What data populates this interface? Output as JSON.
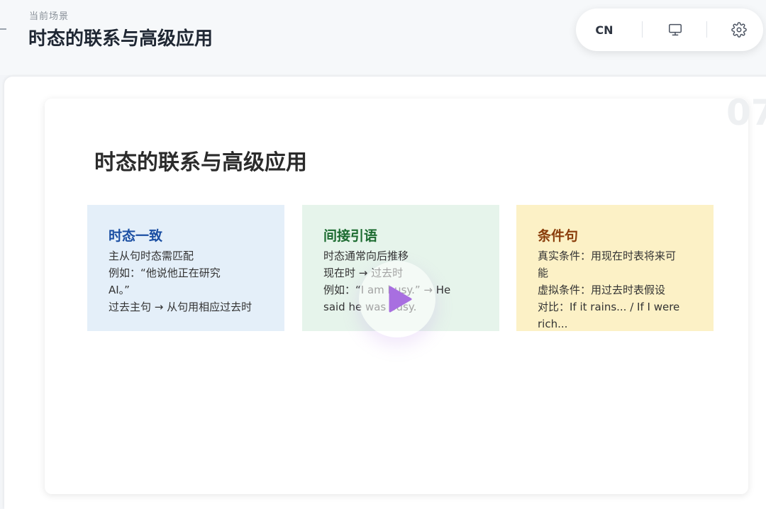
{
  "header": {
    "scene_label": "当前场景",
    "scene_title": "时态的联系与高级应用"
  },
  "controls": {
    "language": "CN",
    "icons": [
      "monitor-icon",
      "gear-icon"
    ]
  },
  "slide": {
    "number": "07",
    "title": "时态的联系与高级应用",
    "cards": [
      {
        "title": "时态一致",
        "color": "#1b4fa3",
        "background": "#e4eff9",
        "lines": [
          "主从句时态需匹配",
          "例如：“他说他正在研究",
          "AI。”",
          "过去主句 → 从句用相应过去时"
        ]
      },
      {
        "title": "间接引语",
        "color": "#1c6b30",
        "background": "#e6f4eb",
        "lines": [
          "时态通常向后推移",
          "现在时 → 过去时",
          "例如：“I am busy.” → He",
          "said he was busy."
        ]
      },
      {
        "title": "条件句",
        "color": "#8a3d0b",
        "background": "#fcf1c6",
        "lines": [
          "真实条件：用现在时表将来可",
          "能",
          "虚拟条件：用过去时表假设",
          "对比：If it rains... / If I were",
          "rich..."
        ]
      }
    ]
  },
  "play_button": {
    "icon": "play-icon",
    "color": "#a86fe0"
  }
}
